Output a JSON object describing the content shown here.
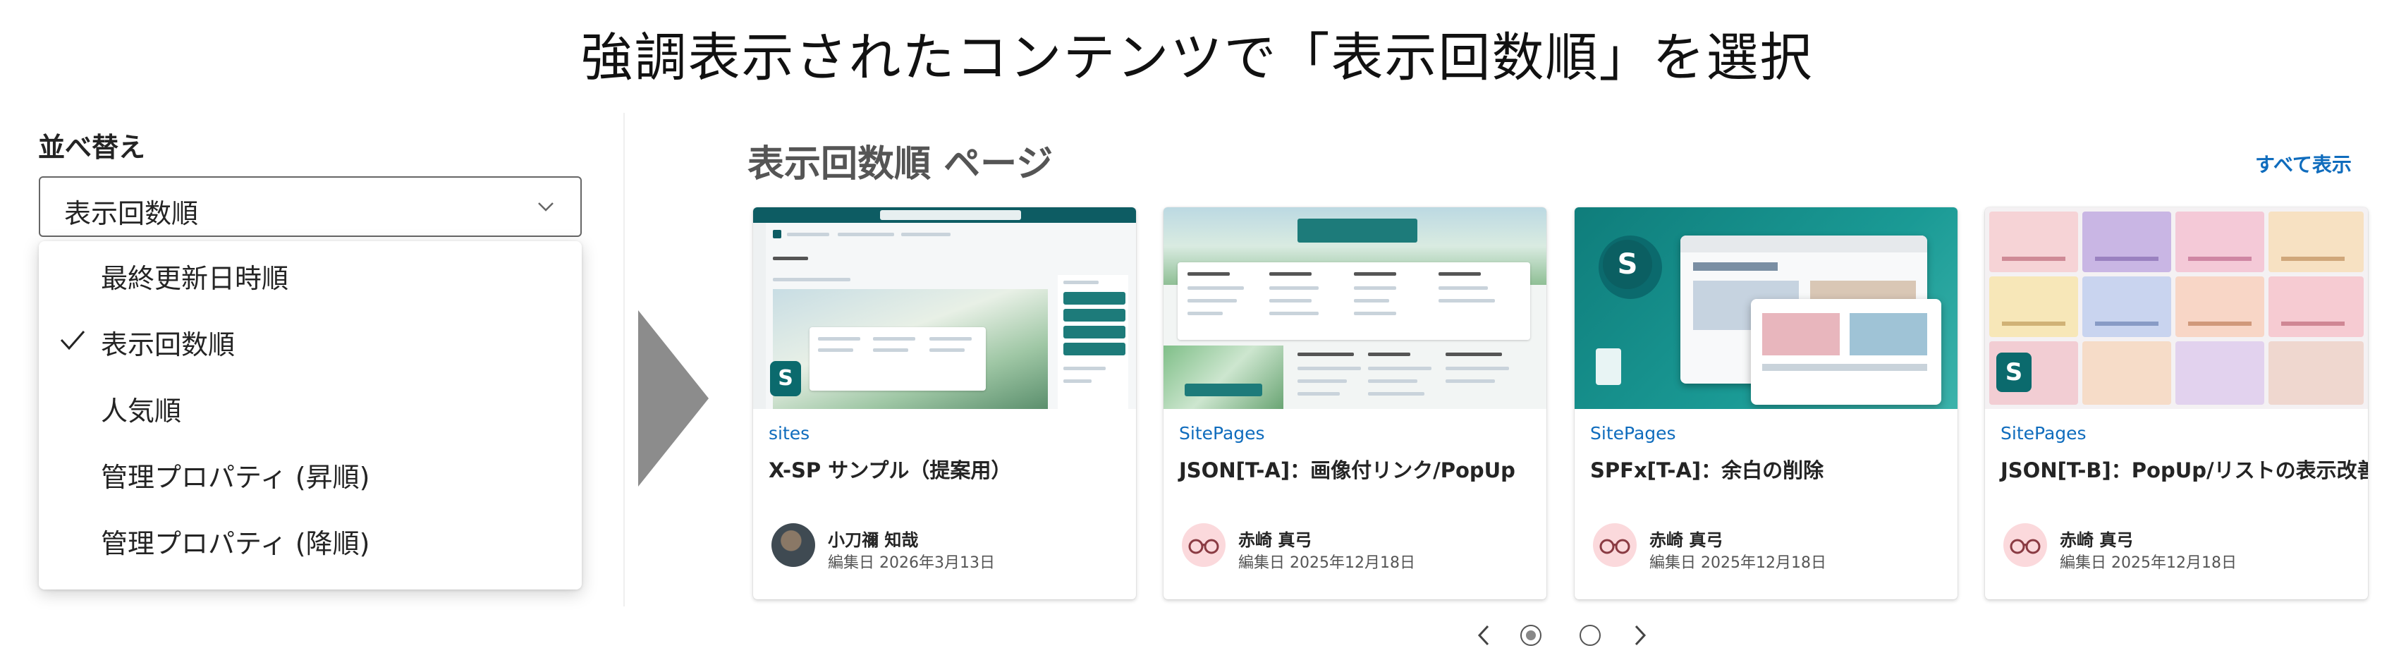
{
  "headline": "強調表示されたコンテンツで「表示回数順」を選択",
  "sort_panel": {
    "label": "並べ替え",
    "selected": "表示回数順",
    "options": [
      {
        "label": "最終更新日時順",
        "checked": false
      },
      {
        "label": "表示回数順",
        "checked": true
      },
      {
        "label": "人気順",
        "checked": false
      },
      {
        "label": "管理プロパティ (昇順)",
        "checked": false
      },
      {
        "label": "管理プロパティ (降順)",
        "checked": false
      }
    ]
  },
  "webpart": {
    "title": "表示回数順 ページ",
    "see_all": "すべて表示",
    "cards": [
      {
        "site": "sites",
        "title": "X-SP サンプル（提案用）",
        "author": "小刀禰 知哉",
        "edited": "編集日 2026年3月13日"
      },
      {
        "site": "SitePages",
        "title": "JSON[T-A]：画像付リンク/PopUp",
        "author": "赤崎 真弓",
        "edited": "編集日 2025年12月18日"
      },
      {
        "site": "SitePages",
        "title": "SPFx[T-A]：余白の削除",
        "author": "赤崎 真弓",
        "edited": "編集日 2025年12月18日"
      },
      {
        "site": "SitePages",
        "title": "JSON[T-B]：PopUp/リストの表示改善",
        "author": "赤崎 真弓",
        "edited": "編集日 2025年12月18日"
      }
    ],
    "pager": {
      "current_page": 1,
      "total_pages": 2
    }
  },
  "colors": {
    "accent": "#0f6cbd",
    "teal": "#1d7b7a",
    "arrow": "#8c8c8c"
  }
}
